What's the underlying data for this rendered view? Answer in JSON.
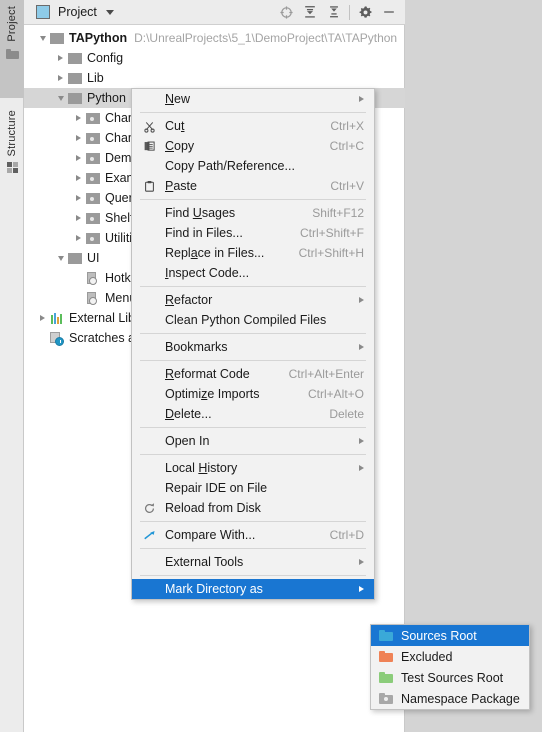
{
  "toolstrip": {
    "tabs": [
      {
        "label": "Project",
        "icon": "folder-icon",
        "selected": true
      },
      {
        "label": "Structure",
        "icon": "grid-icon",
        "selected": false
      }
    ]
  },
  "panel": {
    "title": "Project",
    "icon": "project-view-icon",
    "dropdown_caret": "chevron-down-icon",
    "toolbar": [
      {
        "name": "locate-icon",
        "title": "Select Opened File"
      },
      {
        "name": "expand-all-icon",
        "title": "Expand All"
      },
      {
        "name": "collapse-all-icon",
        "title": "Collapse All"
      },
      {
        "name": "settings-gear-icon",
        "title": "Settings"
      },
      {
        "name": "minimize-icon",
        "title": "Hide"
      }
    ]
  },
  "tree": {
    "items": [
      {
        "label": "TAPython",
        "path": "D:\\UnrealProjects\\5_1\\DemoProject\\TA\\TAPython",
        "depth": 0,
        "arrow": "down",
        "icon": "folder",
        "bold": true,
        "selected": false
      },
      {
        "label": "Config",
        "path": "",
        "depth": 1,
        "arrow": "right",
        "icon": "folder",
        "bold": false,
        "selected": false
      },
      {
        "label": "Lib",
        "path": "",
        "depth": 1,
        "arrow": "right",
        "icon": "folder",
        "bold": false,
        "selected": false
      },
      {
        "label": "Python",
        "path": "",
        "depth": 1,
        "arrow": "down",
        "icon": "folder",
        "bold": false,
        "selected": true
      },
      {
        "label": "Cham",
        "path": "",
        "depth": 2,
        "arrow": "right",
        "icon": "package",
        "bold": false,
        "selected": false
      },
      {
        "label": "Cham",
        "path": "",
        "depth": 2,
        "arrow": "right",
        "icon": "package",
        "bold": false,
        "selected": false
      },
      {
        "label": "Demo",
        "path": "",
        "depth": 2,
        "arrow": "right",
        "icon": "package",
        "bold": false,
        "selected": false
      },
      {
        "label": "Exam",
        "path": "",
        "depth": 2,
        "arrow": "right",
        "icon": "package",
        "bold": false,
        "selected": false
      },
      {
        "label": "Query",
        "path": "",
        "depth": 2,
        "arrow": "right",
        "icon": "package",
        "bold": false,
        "selected": false
      },
      {
        "label": "ShelfT",
        "path": "",
        "depth": 2,
        "arrow": "right",
        "icon": "package",
        "bold": false,
        "selected": false
      },
      {
        "label": "Utiliti",
        "path": "",
        "depth": 2,
        "arrow": "right",
        "icon": "package",
        "bold": false,
        "selected": false
      },
      {
        "label": "UI",
        "path": "",
        "depth": 1,
        "arrow": "down",
        "icon": "folder",
        "bold": false,
        "selected": false
      },
      {
        "label": "Hotke",
        "path": "",
        "depth": 2,
        "arrow": "none",
        "icon": "python-file",
        "bold": false,
        "selected": false
      },
      {
        "label": "Menu",
        "path": "",
        "depth": 2,
        "arrow": "none",
        "icon": "python-file",
        "bold": false,
        "selected": false
      },
      {
        "label": "External Libr",
        "path": "",
        "depth": 0,
        "arrow": "right",
        "icon": "libraries",
        "bold": false,
        "selected": false
      },
      {
        "label": "Scratches an",
        "path": "",
        "depth": 0,
        "arrow": "none",
        "icon": "scratches",
        "bold": false,
        "selected": false
      }
    ]
  },
  "context_menu": {
    "groups": [
      {
        "items": [
          {
            "label": "New",
            "mnemonic": "N",
            "shortcut": "",
            "icon": "",
            "submenu": true,
            "highlight": false
          }
        ]
      },
      {
        "items": [
          {
            "label": "Cut",
            "mnemonic": "t",
            "shortcut": "Ctrl+X",
            "icon": "scissors-icon",
            "submenu": false,
            "highlight": false
          },
          {
            "label": "Copy",
            "mnemonic": "C",
            "shortcut": "Ctrl+C",
            "icon": "copy-icon",
            "submenu": false,
            "highlight": false
          },
          {
            "label": "Copy Path/Reference...",
            "mnemonic": "",
            "shortcut": "",
            "icon": "",
            "submenu": false,
            "highlight": false
          },
          {
            "label": "Paste",
            "mnemonic": "P",
            "shortcut": "Ctrl+V",
            "icon": "clipboard-icon",
            "submenu": false,
            "highlight": false
          }
        ]
      },
      {
        "items": [
          {
            "label": "Find Usages",
            "mnemonic": "U",
            "shortcut": "Shift+F12",
            "icon": "",
            "submenu": false,
            "highlight": false
          },
          {
            "label": "Find in Files...",
            "mnemonic": "",
            "shortcut": "Ctrl+Shift+F",
            "icon": "",
            "submenu": false,
            "highlight": false
          },
          {
            "label": "Replace in Files...",
            "mnemonic": "a",
            "shortcut": "Ctrl+Shift+H",
            "icon": "",
            "submenu": false,
            "highlight": false
          },
          {
            "label": "Inspect Code...",
            "mnemonic": "I",
            "shortcut": "",
            "icon": "",
            "submenu": false,
            "highlight": false
          }
        ]
      },
      {
        "items": [
          {
            "label": "Refactor",
            "mnemonic": "R",
            "shortcut": "",
            "icon": "",
            "submenu": true,
            "highlight": false
          },
          {
            "label": "Clean Python Compiled Files",
            "mnemonic": "",
            "shortcut": "",
            "icon": "",
            "submenu": false,
            "highlight": false
          }
        ]
      },
      {
        "items": [
          {
            "label": "Bookmarks",
            "mnemonic": "",
            "shortcut": "",
            "icon": "",
            "submenu": true,
            "highlight": false
          }
        ]
      },
      {
        "items": [
          {
            "label": "Reformat Code",
            "mnemonic": "R",
            "shortcut": "Ctrl+Alt+Enter",
            "icon": "",
            "submenu": false,
            "highlight": false
          },
          {
            "label": "Optimize Imports",
            "mnemonic": "z",
            "shortcut": "Ctrl+Alt+O",
            "icon": "",
            "submenu": false,
            "highlight": false
          },
          {
            "label": "Delete...",
            "mnemonic": "D",
            "shortcut": "Delete",
            "icon": "",
            "submenu": false,
            "highlight": false
          }
        ]
      },
      {
        "items": [
          {
            "label": "Open In",
            "mnemonic": "",
            "shortcut": "",
            "icon": "",
            "submenu": true,
            "highlight": false
          }
        ]
      },
      {
        "items": [
          {
            "label": "Local History",
            "mnemonic": "H",
            "shortcut": "",
            "icon": "",
            "submenu": true,
            "highlight": false
          },
          {
            "label": "Repair IDE on File",
            "mnemonic": "",
            "shortcut": "",
            "icon": "",
            "submenu": false,
            "highlight": false
          },
          {
            "label": "Reload from Disk",
            "mnemonic": "",
            "shortcut": "",
            "icon": "reload-icon",
            "submenu": false,
            "highlight": false
          }
        ]
      },
      {
        "items": [
          {
            "label": "Compare With...",
            "mnemonic": "",
            "shortcut": "Ctrl+D",
            "icon": "compare-icon",
            "submenu": false,
            "highlight": false
          }
        ]
      },
      {
        "items": [
          {
            "label": "External Tools",
            "mnemonic": "",
            "shortcut": "",
            "icon": "",
            "submenu": true,
            "highlight": false
          }
        ]
      },
      {
        "items": [
          {
            "label": "Mark Directory as",
            "mnemonic": "",
            "shortcut": "",
            "icon": "",
            "submenu": true,
            "highlight": true
          }
        ]
      }
    ]
  },
  "submenu": {
    "items": [
      {
        "label": "Sources Root",
        "swatch": "blue",
        "color": "#3aa9d8",
        "highlight": true
      },
      {
        "label": "Excluded",
        "swatch": "orange",
        "color": "#ef8256",
        "highlight": false
      },
      {
        "label": "Test Sources Root",
        "swatch": "green",
        "color": "#8bcc7a",
        "highlight": false
      },
      {
        "label": "Namespace Package",
        "swatch": "grey",
        "color": "#a8a8a8",
        "highlight": false
      }
    ]
  },
  "colors": {
    "accent_highlight": "#1976d2",
    "panel_bg": "#ffffff",
    "menu_bg": "#f2f2f2",
    "chrome_bg": "#ececec",
    "outer_bg": "#d4d4d4",
    "tree_selected": "#d6d6d6",
    "path_text": "#a4a4a4"
  }
}
